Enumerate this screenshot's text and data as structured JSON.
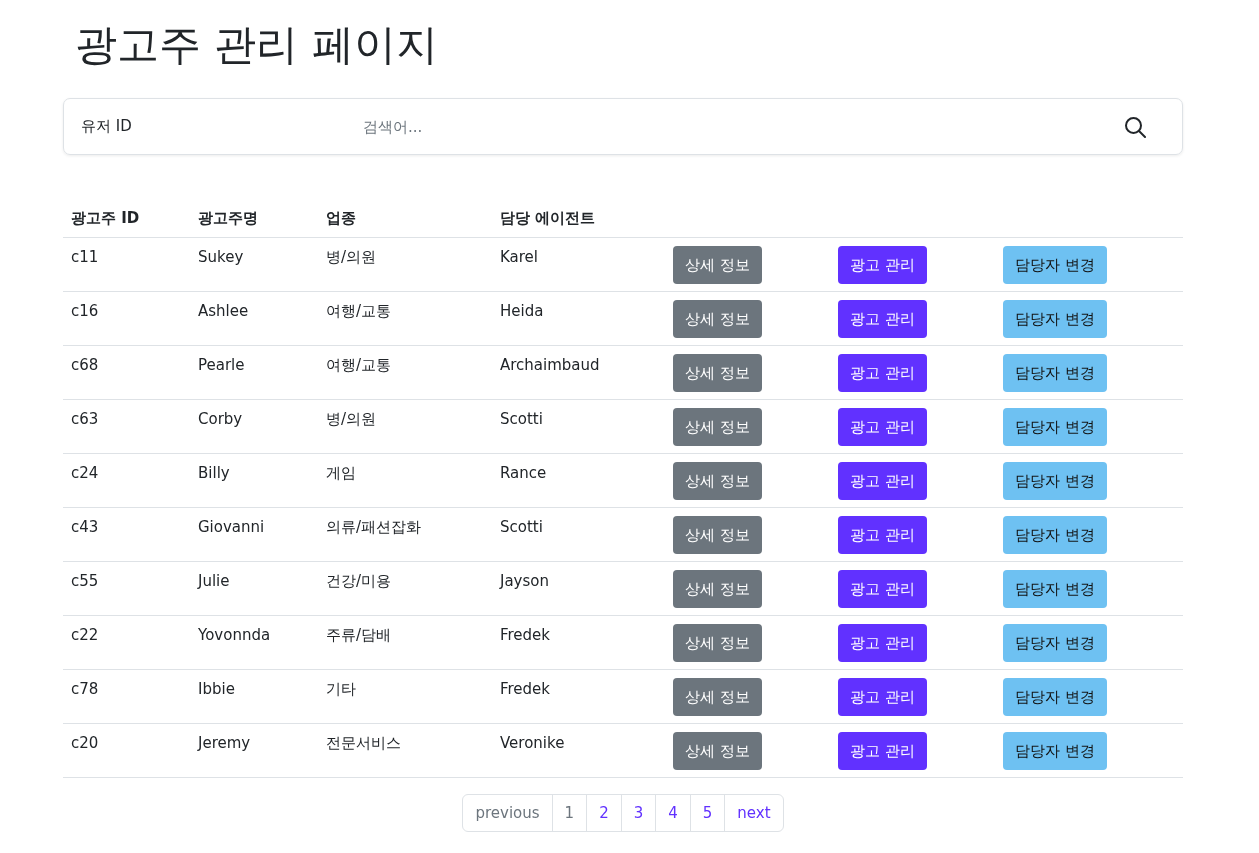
{
  "title": "광고주 관리 페이지",
  "search": {
    "label": "유저 ID",
    "placeholder": "검색어..."
  },
  "table": {
    "columns": [
      "광고주 ID",
      "광고주명",
      "업종",
      "담당 에이전트"
    ],
    "rows": [
      {
        "id": "c11",
        "name": "Sukey",
        "industry": "병/의원",
        "agent": "Karel",
        "buttons": [
          {
            "kind": "detail",
            "label": "상세 정보"
          },
          {
            "kind": "ads",
            "label": "광고 관리"
          },
          {
            "kind": "agent",
            "label": "담당자 변경"
          }
        ]
      },
      {
        "id": "c16",
        "name": "Ashlee",
        "industry": "여행/교통",
        "agent": "Heida",
        "buttons": [
          {
            "kind": "detail",
            "label": "상세 정보"
          },
          {
            "kind": "ads",
            "label": "광고 관리"
          },
          {
            "kind": "agent",
            "label": "담당자 변경"
          }
        ]
      },
      {
        "id": "c68",
        "name": "Pearle",
        "industry": "여행/교통",
        "agent": "Archaimbaud",
        "buttons": [
          {
            "kind": "detail",
            "label": "상세 정보"
          },
          {
            "kind": "ads",
            "label": "광고 관리"
          },
          {
            "kind": "agent",
            "label": "담당자 변경"
          }
        ]
      },
      {
        "id": "c63",
        "name": "Corby",
        "industry": "병/의원",
        "agent": "Scotti",
        "buttons": [
          {
            "kind": "detail",
            "label": "상세 정보"
          },
          {
            "kind": "ads",
            "label": "광고 관리"
          },
          {
            "kind": "agent",
            "label": "담당자 변경"
          }
        ]
      },
      {
        "id": "c24",
        "name": "Billy",
        "industry": "게임",
        "agent": "Rance",
        "buttons": [
          {
            "kind": "detail",
            "label": "상세 정보"
          },
          {
            "kind": "ads",
            "label": "광고 관리"
          },
          {
            "kind": "agent",
            "label": "담당자 변경"
          }
        ]
      },
      {
        "id": "c43",
        "name": "Giovanni",
        "industry": "의류/패션잡화",
        "agent": "Scotti",
        "buttons": [
          {
            "kind": "detail",
            "label": "상세 정보"
          },
          {
            "kind": "ads",
            "label": "광고 관리"
          },
          {
            "kind": "agent",
            "label": "담당자 변경"
          }
        ]
      },
      {
        "id": "c55",
        "name": "Julie",
        "industry": "건강/미용",
        "agent": "Jayson",
        "buttons": [
          {
            "kind": "detail",
            "label": "상세 정보"
          },
          {
            "kind": "ads",
            "label": "광고 관리"
          },
          {
            "kind": "agent",
            "label": "담당자 변경"
          }
        ]
      },
      {
        "id": "c22",
        "name": "Yovonnda",
        "industry": "주류/담배",
        "agent": "Fredek",
        "buttons": [
          {
            "kind": "detail",
            "label": "상세 정보"
          },
          {
            "kind": "ads",
            "label": "광고 관리"
          },
          {
            "kind": "agent",
            "label": "담당자 변경"
          }
        ]
      },
      {
        "id": "c78",
        "name": "Ibbie",
        "industry": "기타",
        "agent": "Fredek",
        "buttons": [
          {
            "kind": "detail",
            "label": "상세 정보"
          },
          {
            "kind": "ads",
            "label": "광고 관리"
          },
          {
            "kind": "agent",
            "label": "담당자 변경"
          }
        ]
      },
      {
        "id": "c20",
        "name": "Jeremy",
        "industry": "전문서비스",
        "agent": "Veronike",
        "buttons": [
          {
            "kind": "detail",
            "label": "상세 정보"
          },
          {
            "kind": "ads",
            "label": "광고 관리"
          },
          {
            "kind": "agent",
            "label": "담당자 변경"
          }
        ]
      }
    ]
  },
  "pagination": {
    "previous": {
      "label": "previous",
      "disabled": true
    },
    "pages": [
      {
        "label": "1",
        "selected": true
      },
      {
        "label": "2",
        "selected": false
      },
      {
        "label": "3",
        "selected": false
      },
      {
        "label": "4",
        "selected": false
      },
      {
        "label": "5",
        "selected": false
      }
    ],
    "next": {
      "label": "next",
      "disabled": false
    }
  }
}
